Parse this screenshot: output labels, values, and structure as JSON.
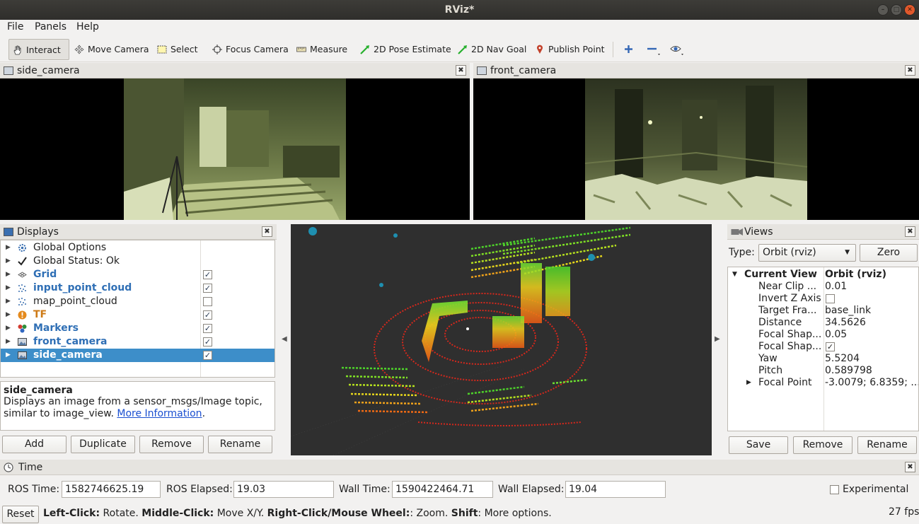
{
  "window": {
    "title": "RViz*"
  },
  "menu": [
    "File",
    "Panels",
    "Help"
  ],
  "toolbar": {
    "interact": "Interact",
    "move_camera": "Move Camera",
    "select": "Select",
    "focus_camera": "Focus Camera",
    "measure": "Measure",
    "pose_estimate": "2D Pose Estimate",
    "nav_goal": "2D Nav Goal",
    "publish_point": "Publish Point"
  },
  "side_camera": {
    "title": "side_camera"
  },
  "front_camera": {
    "title": "front_camera"
  },
  "displays": {
    "title": "Displays",
    "items": [
      {
        "label": "Global Options",
        "checkbox": ""
      },
      {
        "label": "Global Status: Ok",
        "checkbox": ""
      },
      {
        "label": "Grid",
        "checkbox": "✓"
      },
      {
        "label": "input_point_cloud",
        "checkbox": "✓"
      },
      {
        "label": "map_point_cloud",
        "checkbox": ""
      },
      {
        "label": "TF",
        "checkbox": "✓"
      },
      {
        "label": "Markers",
        "checkbox": "✓"
      },
      {
        "label": "front_camera",
        "checkbox": "✓"
      },
      {
        "label": "side_camera",
        "checkbox": "✓"
      }
    ],
    "desc_title": "side_camera",
    "desc_text": "Displays an image from a sensor_msgs/Image topic, similar to image_view.",
    "desc_link": "More Information",
    "buttons": {
      "add": "Add",
      "duplicate": "Duplicate",
      "remove": "Remove",
      "rename": "Rename"
    }
  },
  "views": {
    "title": "Views",
    "type_label": "Type:",
    "type_value": "Orbit (rviz)",
    "zero": "Zero",
    "current_view_label": "Current View",
    "current_view_value": "Orbit (rviz)",
    "props": [
      {
        "name": "Near Clip ...",
        "value": "0.01"
      },
      {
        "name": "Invert Z Axis",
        "value": ""
      },
      {
        "name": "Target Fra...",
        "value": "base_link"
      },
      {
        "name": "Distance",
        "value": "34.5626"
      },
      {
        "name": "Focal Shap...",
        "value": "0.05"
      },
      {
        "name": "Focal Shap...",
        "value": "✓"
      },
      {
        "name": "Yaw",
        "value": "5.5204"
      },
      {
        "name": "Pitch",
        "value": "0.589798"
      },
      {
        "name": "Focal Point",
        "value": "-3.0079; 6.8359; ..."
      }
    ],
    "buttons": {
      "save": "Save",
      "remove": "Remove",
      "rename": "Rename"
    }
  },
  "time": {
    "title": "Time",
    "ros_time_label": "ROS Time:",
    "ros_time": "1582746625.19",
    "ros_elapsed_label": "ROS Elapsed:",
    "ros_elapsed": "19.03",
    "wall_time_label": "Wall Time:",
    "wall_time": "1590422464.71",
    "wall_elapsed_label": "Wall Elapsed:",
    "wall_elapsed": "19.04",
    "experimental": "Experimental"
  },
  "status": {
    "reset": "Reset",
    "left_click": "Left-Click:",
    "left_action": "Rotate.",
    "middle_click": "Middle-Click:",
    "middle_action": "Move X/Y.",
    "right_click": "Right-Click/Mouse Wheel:",
    "right_action": ": Zoom.",
    "shift": "Shift",
    "shift_action": ": More options.",
    "fps": "27 fps"
  },
  "colors": {
    "selection": "#3d8ec9",
    "link": "#2f6fb5",
    "viewport_bg": "#2f2f2f"
  }
}
